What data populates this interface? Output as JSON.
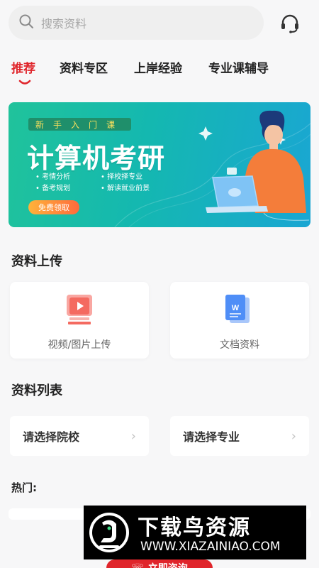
{
  "search": {
    "placeholder": "搜索资料",
    "icon": "search-icon"
  },
  "header": {
    "support_icon": "headset-icon"
  },
  "tabs": [
    {
      "label": "推荐",
      "active": true
    },
    {
      "label": "资料专区",
      "active": false
    },
    {
      "label": "上岸经验",
      "active": false
    },
    {
      "label": "专业课辅导",
      "active": false
    }
  ],
  "banner": {
    "top_label": "新手入门课",
    "title": "计算机考研",
    "bullets": [
      "考情分析",
      "择校择专业",
      "备考规划",
      "解读就业前景"
    ],
    "cta": "免费领取"
  },
  "upload": {
    "title": "资料上传",
    "cards": [
      {
        "label": "视频/图片上传",
        "icon": "video-upload-icon"
      },
      {
        "label": "文档资料",
        "icon": "word-document-icon"
      }
    ]
  },
  "list": {
    "title": "资料列表",
    "selects": [
      {
        "label": "请选择院校"
      },
      {
        "label": "请选择专业"
      }
    ]
  },
  "hot": {
    "label": "热门:"
  },
  "watermark": {
    "title": "下载鸟资源",
    "url": "WWW.XIAZAINIAO.COM"
  },
  "consult_button": {
    "label": "立即咨询"
  },
  "colors": {
    "accent": "#e0252b",
    "banner_start": "#20c39b",
    "banner_end": "#1aa6d3",
    "background": "#f7f7f8"
  }
}
